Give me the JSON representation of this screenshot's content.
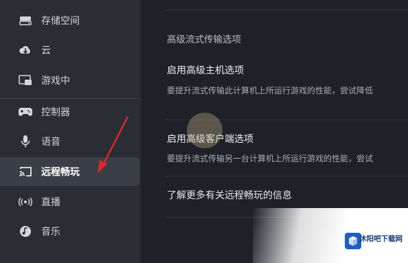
{
  "sidebar": {
    "items": [
      {
        "label": "存储空间",
        "icon": "storage-icon"
      },
      {
        "label": "云",
        "icon": "cloud-icon"
      },
      {
        "label": "游戏中",
        "icon": "in-game-icon"
      },
      {
        "label": "控制器",
        "icon": "controller-icon"
      },
      {
        "label": "语音",
        "icon": "microphone-icon"
      },
      {
        "label": "远程畅玩",
        "icon": "remote-play-icon",
        "active": true
      },
      {
        "label": "直播",
        "icon": "broadcast-icon"
      },
      {
        "label": "音乐",
        "icon": "music-icon"
      }
    ]
  },
  "main": {
    "section_title": "高级流式传输选项",
    "host_option": {
      "title": "启用高级主机选项",
      "desc": "要提升流式传输此计算机上所运行游戏的性能，尝试降低"
    },
    "client_option": {
      "title": "启用高级客户端选项",
      "desc": "要提升流式传输另一台计算机上所运行游戏的性能，尝试"
    },
    "learn_more": "了解更多有关远程畅玩的信息"
  },
  "watermark": {
    "name": "沐阳吧下载网"
  },
  "colors": {
    "sidebar_bg": "#2a2d33",
    "main_bg": "#1f2128",
    "active_bg": "#3a3e46",
    "annotation": "#e5262b"
  }
}
